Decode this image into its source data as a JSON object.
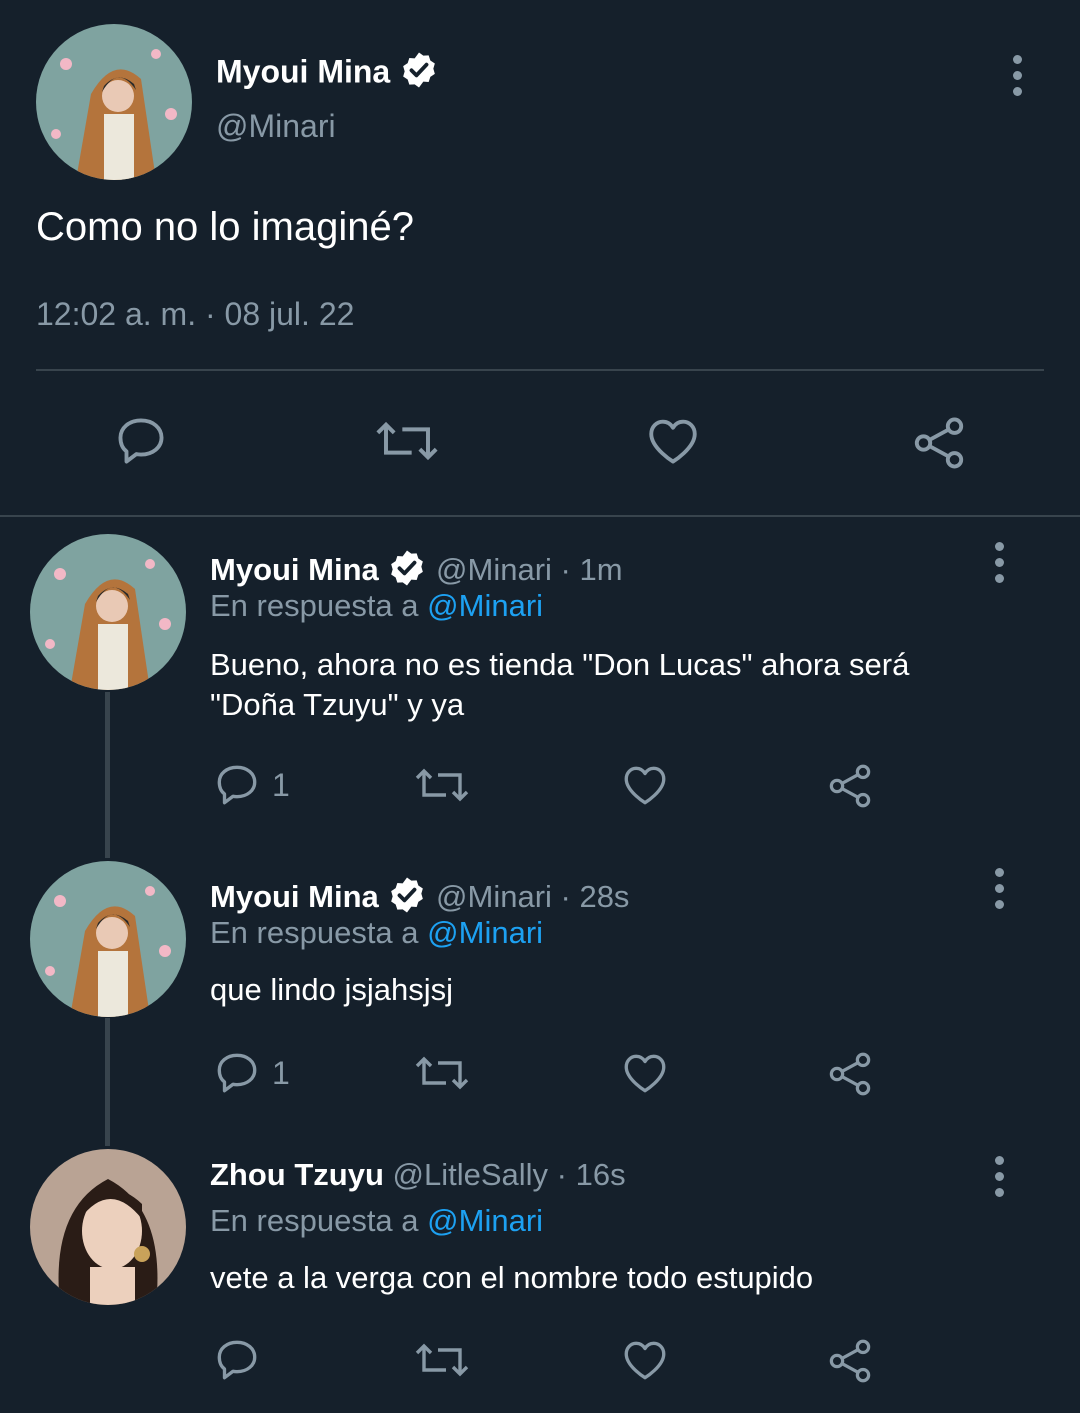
{
  "main_tweet": {
    "author_name": "Myoui Mina",
    "handle": "@Minari",
    "text": "Como no lo imaginé?",
    "timestamp": "12:02 a. m. · 08 jul. 22"
  },
  "replies": [
    {
      "author_name": "Myoui Mina",
      "meta": "@Minari · 1m",
      "reply_prefix": "En respuesta a",
      "reply_to": "@Minari",
      "text_line1": "Bueno, ahora no es tienda \"Don Lucas\" ahora será",
      "text_line2": "\"Doña Tzuyu\" y ya",
      "reply_count": "1"
    },
    {
      "author_name": "Myoui Mina",
      "meta": "@Minari · 28s",
      "reply_prefix": "En respuesta a",
      "reply_to": "@Minari",
      "text": "que lindo jsjahsjsj",
      "reply_count": "1"
    },
    {
      "author_name": "Zhou Tzuyu",
      "meta": "@LitleSally · 16s",
      "reply_prefix": "En respuesta a",
      "reply_to": "@Minari",
      "text": "vete a la verga con el nombre todo estupido"
    }
  ],
  "colors": {
    "background": "#15202b",
    "muted": "#8899a6",
    "link": "#1da1f2",
    "divider": "#38444d"
  },
  "icons": [
    "verified-icon",
    "more-icon",
    "reply-icon",
    "retweet-icon",
    "like-icon",
    "share-icon"
  ]
}
